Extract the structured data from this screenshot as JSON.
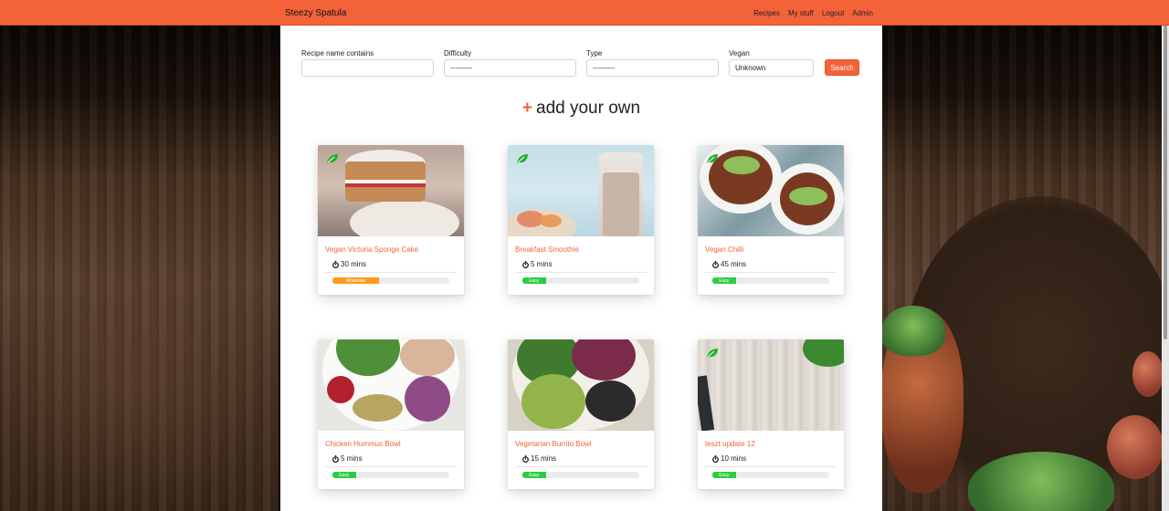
{
  "navbar": {
    "brand": "Steezy Spatula",
    "links": [
      "Recipes",
      "My stuff",
      "Logout",
      "Admin"
    ],
    "color": "#f4623a"
  },
  "filters": {
    "name": {
      "label": "Recipe name contains",
      "value": ""
    },
    "difficulty": {
      "label": "Difficulty",
      "value": "---------"
    },
    "type": {
      "label": "Type",
      "value": "---------"
    },
    "vegan": {
      "label": "Vegan",
      "value": "Unknown"
    },
    "search_label": "Search"
  },
  "add_own": {
    "plus": "+",
    "label": "add your own"
  },
  "recipes": [
    {
      "title": "Vegan Victoria Sponge Cake",
      "time": "30 mins",
      "difficulty": "Moderate",
      "difficulty_fraction": 0.4,
      "difficulty_color": "#fd9a1c",
      "vegan": true,
      "image": "sponge-cake"
    },
    {
      "title": "Breakfast Smoothie",
      "time": "5 mins",
      "difficulty": "Easy",
      "difficulty_fraction": 0.2,
      "difficulty_color": "#2ecc40",
      "vegan": true,
      "image": "smoothie"
    },
    {
      "title": "Vegan Chilli",
      "time": "45 mins",
      "difficulty": "Easy",
      "difficulty_fraction": 0.2,
      "difficulty_color": "#2ecc40",
      "vegan": true,
      "image": "chilli"
    },
    {
      "title": "Chicken Hummus Bowl",
      "time": "5 mins",
      "difficulty": "Easy",
      "difficulty_fraction": 0.2,
      "difficulty_color": "#2ecc40",
      "vegan": false,
      "image": "hummus-bowl"
    },
    {
      "title": "Vegetarian Burrito Bowl",
      "time": "15 mins",
      "difficulty": "Easy",
      "difficulty_fraction": 0.2,
      "difficulty_color": "#2ecc40",
      "vegan": false,
      "image": "burrito-bowl"
    },
    {
      "title": "teszt update 12",
      "time": "10 mins",
      "difficulty": "Easy",
      "difficulty_fraction": 0.2,
      "difficulty_color": "#2ecc40",
      "vegan": true,
      "image": "wood-board"
    }
  ]
}
